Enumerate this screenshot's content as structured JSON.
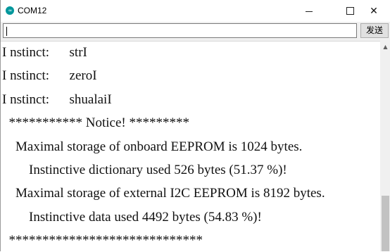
{
  "window": {
    "title": "COM12",
    "icon_text": "∞"
  },
  "controls": {
    "minimize_icon": "minimize-icon",
    "maximize_icon": "maximize-icon",
    "close_icon": "close-icon",
    "close_glyph": "✕"
  },
  "send_bar": {
    "input_value": "",
    "send_label": "发送"
  },
  "output_lines": [
    "I nstinct:      strI",
    "I nstinct:      zeroI",
    "I nstinct:      shualaiI",
    "  *********** Notice! *********",
    "    Maximal storage of onboard EEPROM is 1024 bytes.",
    "        Instinctive dictionary used 526 bytes (51.37 %)!",
    "    Maximal storage of external I2C EEPROM is 8192 bytes.",
    "        Instinctive data used 4492 bytes (54.83 %)!",
    "  *****************************"
  ],
  "scrollbar": {
    "up_arrow": "▲"
  },
  "colors": {
    "arduino_teal": "#00979c",
    "toolbar_bg": "#f0f0f0",
    "scroll_thumb": "#c2c2c2"
  }
}
